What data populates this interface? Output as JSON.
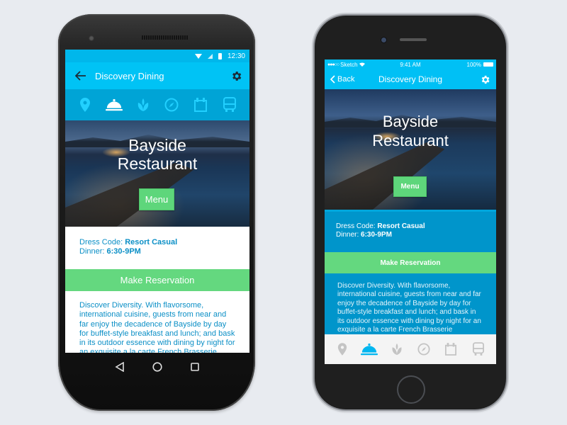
{
  "colors": {
    "accent_blue": "#00c3f5",
    "tab_strip_blue": "#00a4d6",
    "info_text_blue": "#0b8fc6",
    "ios_panel_blue": "#0095cb",
    "green": "#64d87f",
    "ios_tab_active": "#00b6f0",
    "ios_tab_inactive": "#c4c4c4",
    "android_tab_inactive": "#22d0ff"
  },
  "android": {
    "status": {
      "time": "12:30",
      "icons": [
        "wifi-icon",
        "signal-icon",
        "battery-icon"
      ]
    },
    "appbar": {
      "back_icon": "arrow-left-icon",
      "title": "Discovery Dining",
      "settings_icon": "gear-icon"
    },
    "tabs": [
      {
        "name": "location",
        "icon": "map-pin-icon",
        "active": false
      },
      {
        "name": "dining",
        "icon": "food-cloche-icon",
        "active": true
      },
      {
        "name": "spa",
        "icon": "leaf-icon",
        "active": false
      },
      {
        "name": "explore",
        "icon": "compass-icon",
        "active": false
      },
      {
        "name": "events",
        "icon": "calendar-icon",
        "active": false
      },
      {
        "name": "transport",
        "icon": "bus-icon",
        "active": false
      }
    ],
    "hero": {
      "title_line1": "Bayside",
      "title_line2": "Restaurant",
      "menu_label": "Menu"
    },
    "info": {
      "dress_code_label": "Dress Code: ",
      "dress_code_value": "Resort Casual",
      "dinner_label": "Dinner: ",
      "dinner_value": "6:30-9PM"
    },
    "reserve_label": "Make Reservation",
    "description": "Discover Diversity. With flavorsome, international cuisine, guests from near and far enjoy the decadence of Bayside by day for buffet-style breakfast and lunch; and bask in its outdoor essence with dining by night for an exquisite a la carte French Brasserie",
    "nav": [
      "back-triangle-icon",
      "home-circle-icon",
      "recents-square-icon"
    ]
  },
  "ios": {
    "status": {
      "carrier": "Sketch",
      "signal_dots": "●●●○○",
      "time": "9:41 AM",
      "battery": "100%"
    },
    "navbar": {
      "back_label": "Back",
      "title": "Discovery Dining",
      "settings_icon": "gear-icon"
    },
    "hero": {
      "title_line1": "Bayside",
      "title_line2": "Restaurant",
      "menu_label": "Menu"
    },
    "info": {
      "dress_code_label": "Dress Code: ",
      "dress_code_value": "Resort Casual",
      "dinner_label": "Dinner: ",
      "dinner_value": "6:30-9PM"
    },
    "reserve_label": "Make Reservation",
    "description": "Discover Diversity. With flavorsome, international cuisine, guests from near and far enjoy the decadence of Bayside by day for buffet-style breakfast and lunch; and bask in its outdoor essence with dining by night for an exquisite a la carte French Brasserie experience. The character of",
    "tabs": [
      {
        "name": "location",
        "icon": "map-pin-icon",
        "active": false
      },
      {
        "name": "dining",
        "icon": "food-cloche-icon",
        "active": true
      },
      {
        "name": "spa",
        "icon": "leaf-icon",
        "active": false
      },
      {
        "name": "explore",
        "icon": "compass-icon",
        "active": false
      },
      {
        "name": "events",
        "icon": "calendar-icon",
        "active": false
      },
      {
        "name": "transport",
        "icon": "bus-icon",
        "active": false
      }
    ]
  }
}
